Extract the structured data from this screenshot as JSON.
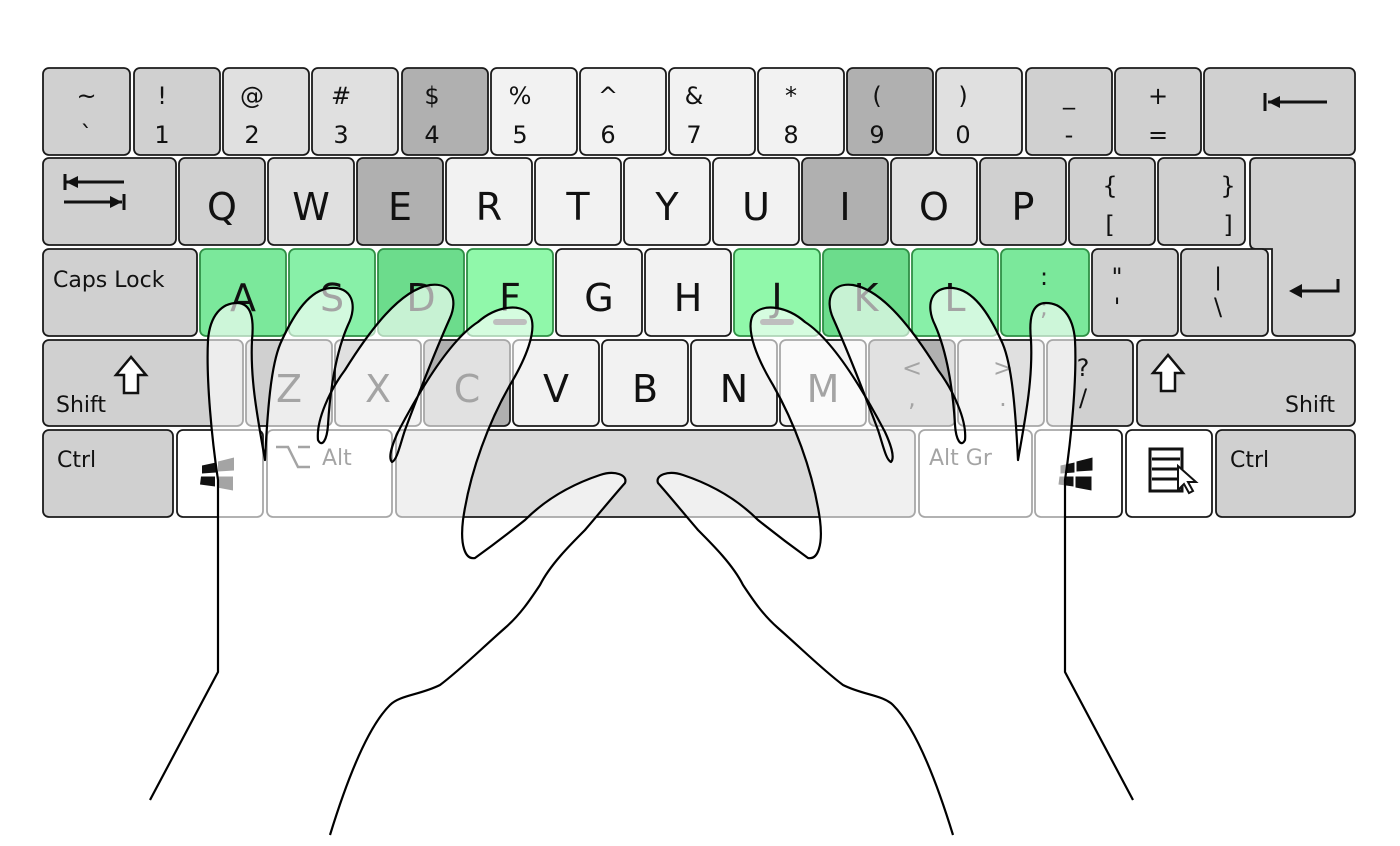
{
  "colors": {
    "pinky": "#d0d0d0",
    "ring": "#e0e0e0",
    "middle": "#b0b0b0",
    "index": "#f2f2f2",
    "thumb": "#d8d8d8",
    "other": "#ffffff",
    "home_pinky": "#7be89b",
    "home_ring": "#88f0a8",
    "home_middle": "#6cdc8c",
    "home_index": "#90f8aa",
    "home_border": "#2f8f45",
    "hand_fill": "rgba(255,255,255,0.62)"
  },
  "keyboard": {
    "rows": [
      {
        "keys": [
          {
            "top": "~",
            "bottom": "`",
            "finger": "pinky"
          },
          {
            "top": "!",
            "bottom": "1",
            "finger": "pinky"
          },
          {
            "top": "@",
            "bottom": "2",
            "finger": "ring"
          },
          {
            "top": "#",
            "bottom": "3",
            "finger": "ring"
          },
          {
            "top": "$",
            "bottom": "4",
            "finger": "middle"
          },
          {
            "top": "%",
            "bottom": "5",
            "finger": "index"
          },
          {
            "top": "^",
            "bottom": "6",
            "finger": "index"
          },
          {
            "top": "&",
            "bottom": "7",
            "finger": "index"
          },
          {
            "top": "*",
            "bottom": "8",
            "finger": "index"
          },
          {
            "top": "(",
            "bottom": "9",
            "finger": "middle"
          },
          {
            "top": ")",
            "bottom": "0",
            "finger": "ring"
          },
          {
            "top": "_",
            "bottom": "-",
            "finger": "pinky"
          },
          {
            "top": "+",
            "bottom": "=",
            "finger": "pinky"
          },
          {
            "icon": "backspace-icon",
            "finger": "pinky"
          }
        ]
      },
      {
        "keys": [
          {
            "icon": "tab-icon",
            "finger": "pinky"
          },
          {
            "label": "Q",
            "finger": "pinky"
          },
          {
            "label": "W",
            "finger": "ring"
          },
          {
            "label": "E",
            "finger": "middle"
          },
          {
            "label": "R",
            "finger": "index"
          },
          {
            "label": "T",
            "finger": "index"
          },
          {
            "label": "Y",
            "finger": "index"
          },
          {
            "label": "U",
            "finger": "index"
          },
          {
            "label": "I",
            "finger": "middle"
          },
          {
            "label": "O",
            "finger": "ring"
          },
          {
            "label": "P",
            "finger": "pinky"
          },
          {
            "top": "{",
            "bottom": "[",
            "finger": "pinky"
          },
          {
            "top": "}",
            "bottom": "]",
            "finger": "pinky"
          },
          {
            "icon": "enter-icon",
            "finger": "pinky"
          }
        ]
      },
      {
        "keys": [
          {
            "label": "Caps Lock",
            "finger": "pinky"
          },
          {
            "label": "A",
            "finger": "home_pinky",
            "home": true
          },
          {
            "label": "S",
            "finger": "home_ring",
            "home": true
          },
          {
            "label": "D",
            "finger": "home_middle",
            "home": true
          },
          {
            "label": "F",
            "finger": "home_index",
            "home": true,
            "bump": true
          },
          {
            "label": "G",
            "finger": "index"
          },
          {
            "label": "H",
            "finger": "index"
          },
          {
            "label": "J",
            "finger": "home_index",
            "home": true,
            "bump": true
          },
          {
            "label": "K",
            "finger": "home_middle",
            "home": true
          },
          {
            "label": "L",
            "finger": "home_ring",
            "home": true
          },
          {
            "top": ":",
            "bottom": ";",
            "finger": "home_pinky",
            "home": true
          },
          {
            "top": "\"",
            "bottom": "'",
            "finger": "pinky"
          },
          {
            "top": "|",
            "bottom": "\\",
            "finger": "pinky"
          }
        ]
      },
      {
        "keys": [
          {
            "label": "Shift",
            "icon": "shift-icon",
            "finger": "pinky"
          },
          {
            "label": "Z",
            "finger": "pinky"
          },
          {
            "label": "X",
            "finger": "ring"
          },
          {
            "label": "C",
            "finger": "middle"
          },
          {
            "label": "V",
            "finger": "index"
          },
          {
            "label": "B",
            "finger": "index"
          },
          {
            "label": "N",
            "finger": "index"
          },
          {
            "label": "M",
            "finger": "index"
          },
          {
            "top": "<",
            "bottom": ",",
            "finger": "middle"
          },
          {
            "top": ">",
            "bottom": ".",
            "finger": "ring"
          },
          {
            "top": "?",
            "bottom": "/",
            "finger": "pinky"
          },
          {
            "label": "Shift",
            "icon": "shift-icon",
            "finger": "pinky"
          }
        ]
      },
      {
        "keys": [
          {
            "label": "Ctrl",
            "finger": "pinky"
          },
          {
            "icon": "windows-icon",
            "finger": "other"
          },
          {
            "label": "Alt",
            "icon": "option-icon",
            "finger": "other"
          },
          {
            "label": "",
            "finger": "thumb"
          },
          {
            "label": "Alt Gr",
            "finger": "other"
          },
          {
            "icon": "windows-icon",
            "finger": "other"
          },
          {
            "icon": "menu-icon",
            "finger": "other"
          },
          {
            "label": "Ctrl",
            "finger": "pinky"
          }
        ]
      }
    ]
  }
}
